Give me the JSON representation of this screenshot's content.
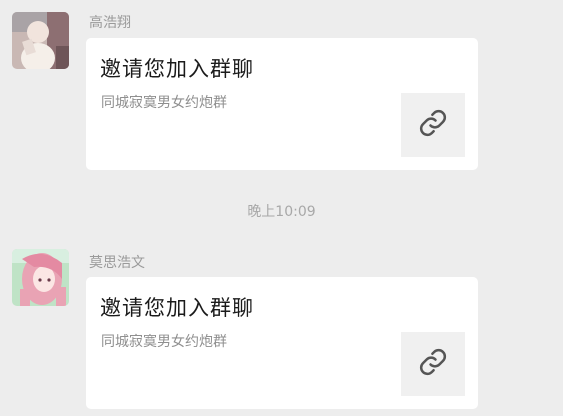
{
  "messages": [
    {
      "sender": "高浩翔",
      "avatar_icon": "user-avatar",
      "card": {
        "title": "邀请您加入群聊",
        "description": "同城寂寞男女约炮群",
        "icon": "link-icon"
      }
    },
    {
      "sender": "莫思浩文",
      "avatar_icon": "anime-girl-avatar",
      "card": {
        "title": "邀请您加入群聊",
        "description": "同城寂寞男女约炮群",
        "icon": "link-icon"
      }
    }
  ],
  "timestamp": "晚上10:09",
  "colors": {
    "background": "#ededed",
    "card": "#ffffff",
    "sender_text": "#9a9a9a",
    "title_text": "#1b1b1b",
    "desc_text": "#8f8f8f"
  }
}
